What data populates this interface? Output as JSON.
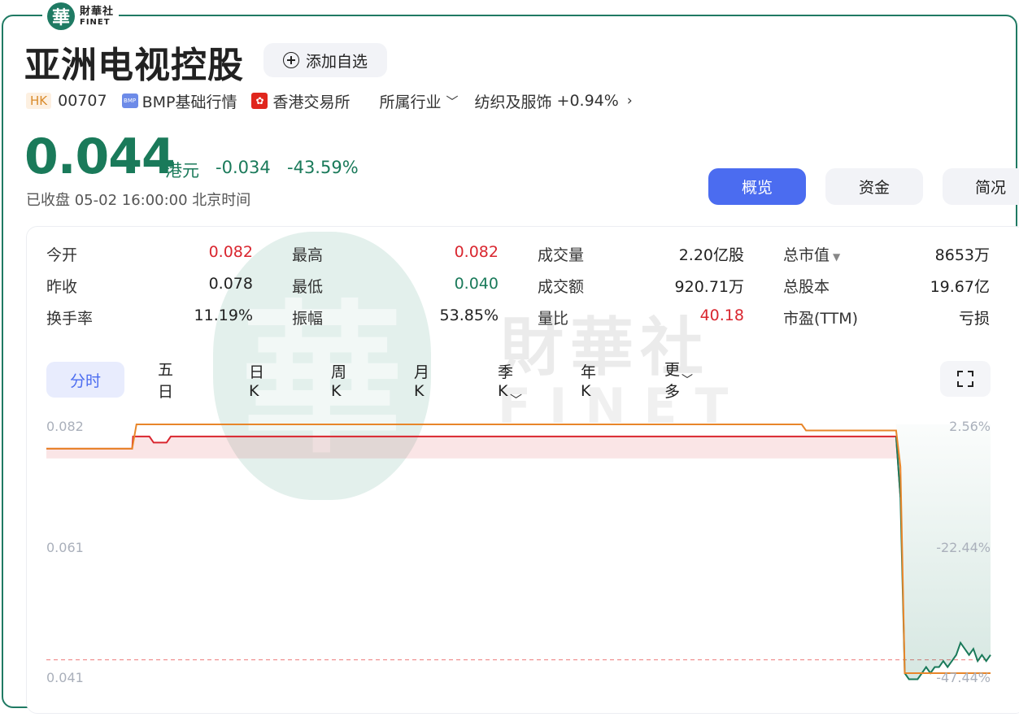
{
  "brand": {
    "seal": "華",
    "name_cn": "財華社",
    "name_en": "FINET"
  },
  "header": {
    "stock_name": "亚洲电视控股",
    "watchlist_label": "添加自选",
    "market": "HK",
    "code": "00707",
    "data_source": "BMP基础行情",
    "exchange": "香港交易所",
    "industry_label": "所属行业",
    "sector": "纺织及服饰",
    "sector_change": "+0.94%"
  },
  "quote": {
    "price": "0.044",
    "currency": "港元",
    "change": "-0.034",
    "change_pct": "-43.59%",
    "status": "已收盘  05-02 16:00:00 北京时间"
  },
  "tabs": [
    "概览",
    "资金",
    "简况"
  ],
  "stats": [
    {
      "label": "今开",
      "value": "0.082",
      "color": "red"
    },
    {
      "label": "最高",
      "value": "0.082",
      "color": "red"
    },
    {
      "label": "成交量",
      "value": "2.20亿股",
      "color": "normal"
    },
    {
      "label": "总市值",
      "value": "8653万",
      "color": "normal"
    },
    {
      "label": "昨收",
      "value": "0.078",
      "color": "normal"
    },
    {
      "label": "最低",
      "value": "0.040",
      "color": "green"
    },
    {
      "label": "成交额",
      "value": "920.71万",
      "color": "normal"
    },
    {
      "label": "总股本",
      "value": "19.67亿",
      "color": "normal"
    },
    {
      "label": "换手率",
      "value": "11.19%",
      "color": "normal"
    },
    {
      "label": "振幅",
      "value": "53.85%",
      "color": "normal"
    },
    {
      "label": "量比",
      "value": "40.18",
      "color": "red"
    },
    {
      "label": "市盈(TTM)",
      "value": "亏损",
      "color": "normal"
    }
  ],
  "periods": [
    "分时",
    "五日",
    "日K",
    "周K",
    "月K",
    "季K",
    "年K",
    "更多"
  ],
  "colors": {
    "up": "#d9262f",
    "down": "#1a7a5a",
    "accent": "#4b6cf0",
    "avg_line": "#e8862a"
  },
  "chart_data": {
    "type": "line",
    "title": "",
    "y_left_ticks": [
      "0.082",
      "0.061",
      "0.041"
    ],
    "y_right_ticks": [
      "2.56%",
      "-22.44%",
      "-47.44%"
    ],
    "ylim": [
      0.041,
      0.082
    ],
    "prev_close": 0.078,
    "series": [
      {
        "name": "",
        "color": "red-then-green",
        "x": [
          0,
          0.1,
          0.101,
          0.12,
          0.125,
          0.14,
          0.145,
          0.99,
          0.995,
          1.0,
          1.005,
          1.015,
          1.02,
          1.025,
          1.03,
          1.035,
          1.04,
          1.045,
          1.05,
          1.055,
          1.06,
          1.065,
          1.07,
          1.075,
          1.08,
          1.085,
          1.09,
          1.095,
          1.1
        ],
        "values": [
          0.078,
          0.078,
          0.08,
          0.08,
          0.079,
          0.079,
          0.08,
          0.08,
          0.07,
          0.041,
          0.04,
          0.04,
          0.041,
          0.042,
          0.041,
          0.042,
          0.042,
          0.043,
          0.042,
          0.043,
          0.044,
          0.046,
          0.045,
          0.044,
          0.045,
          0.043,
          0.044,
          0.043,
          0.044
        ]
      },
      {
        "name": "",
        "color": "orange",
        "x": [
          0,
          0.1,
          0.105,
          0.88,
          0.885,
          0.99,
          0.995,
          1.0,
          1.1
        ],
        "values": [
          0.078,
          0.078,
          0.082,
          0.082,
          0.081,
          0.081,
          0.075,
          0.041,
          0.041
        ]
      }
    ]
  }
}
